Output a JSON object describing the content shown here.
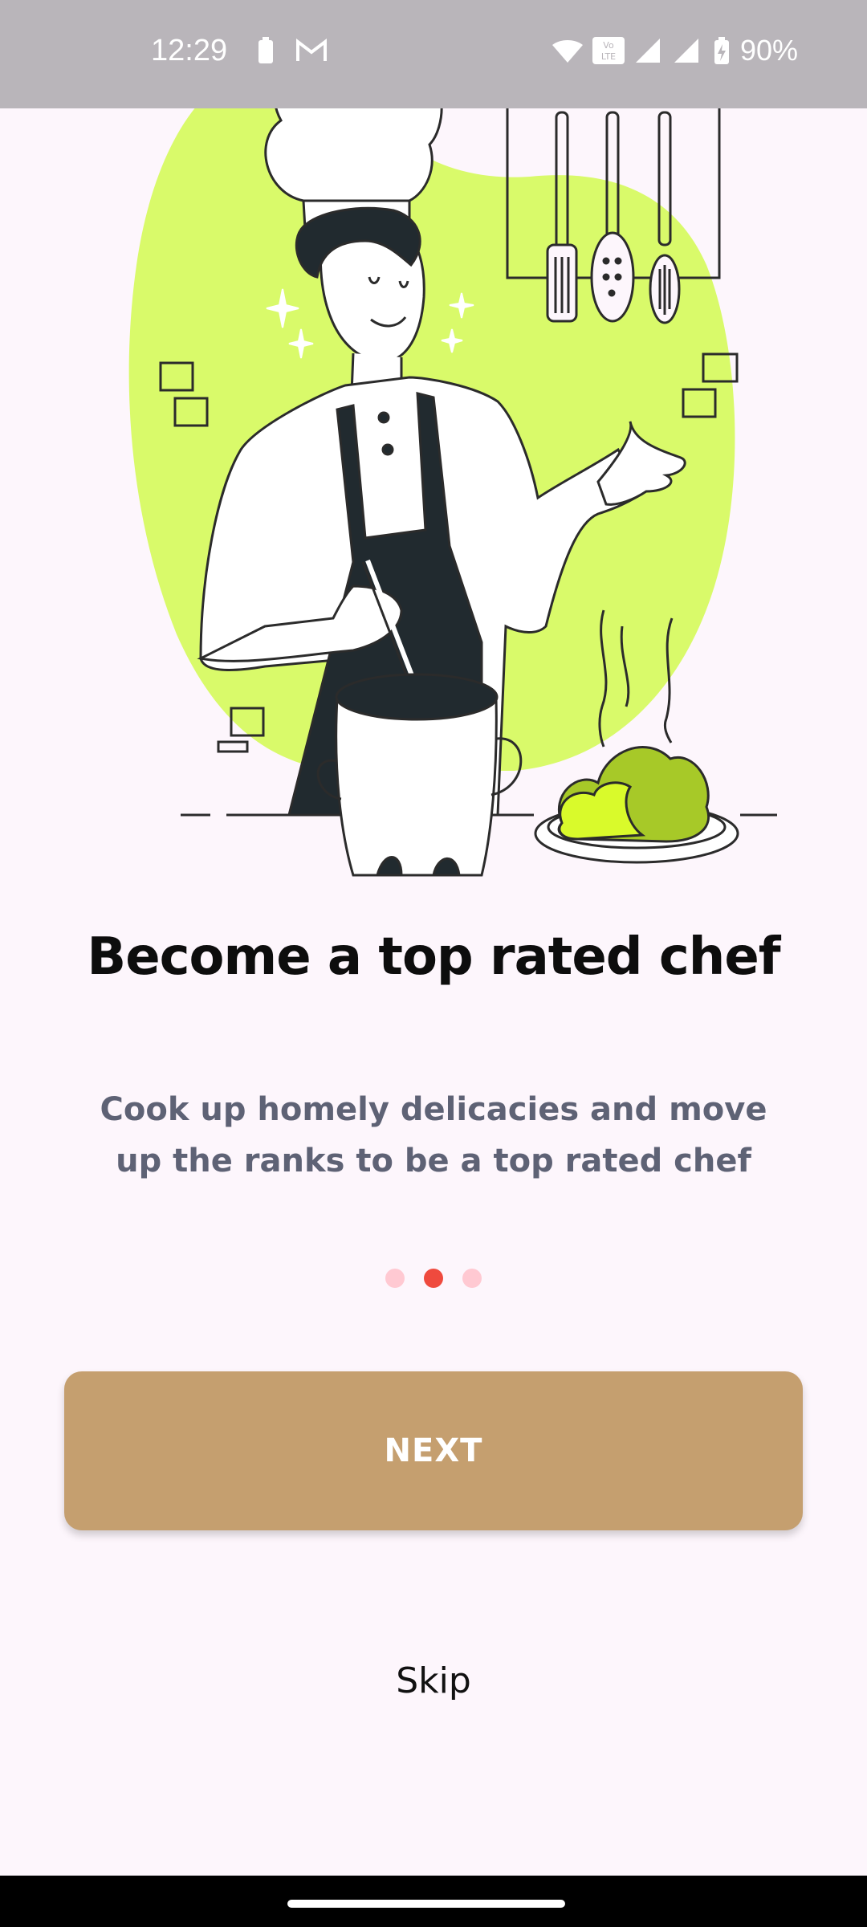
{
  "status_bar": {
    "time": "12:29",
    "battery_percent": "90%",
    "icons": [
      "battery-icon",
      "gmail-icon",
      "wifi-icon",
      "volte-icon",
      "signal-icon",
      "signal-icon",
      "battery-charging-icon"
    ]
  },
  "onboarding": {
    "title": "Become a top rated chef",
    "subtitle": "Cook up homely delicacies and move up the ranks to be a top rated chef",
    "page_indicator": {
      "total": 3,
      "active_index": 1
    },
    "next_label": "NEXT",
    "skip_label": "Skip"
  },
  "colors": {
    "background": "#FDF6FC",
    "accent_blob": "#D9FA6A",
    "button": "#C59F6F",
    "dot_active": "#EF4A3E",
    "dot_inactive": "#FFC9D2",
    "subtitle": "#5E6275"
  }
}
